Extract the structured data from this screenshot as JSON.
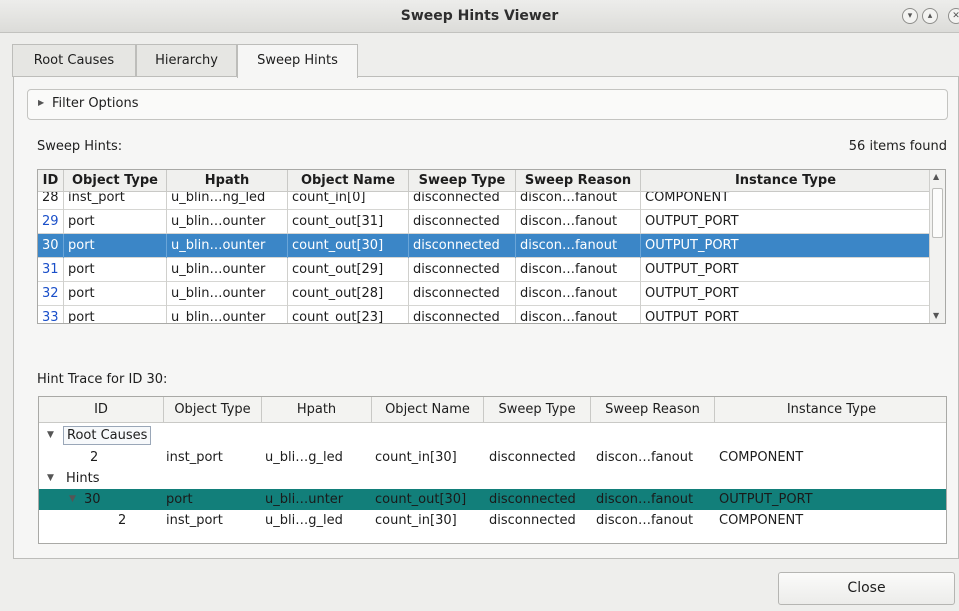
{
  "window": {
    "title": "Sweep Hints Viewer"
  },
  "tabs": [
    {
      "label": "Root Causes"
    },
    {
      "label": "Hierarchy"
    },
    {
      "label": "Sweep Hints",
      "active": true
    }
  ],
  "filter": {
    "label": "Filter Options"
  },
  "sweep_hints": {
    "label": "Sweep Hints:",
    "count": "56 items found",
    "columns": [
      "ID",
      "Object Type",
      "Hpath",
      "Object Name",
      "Sweep Type",
      "Sweep Reason",
      "Instance Type"
    ],
    "rows": [
      [
        "28",
        "inst_port",
        "u_blin…ng_led",
        "count_in[0]",
        "disconnected",
        "discon…fanout",
        "COMPONENT"
      ],
      [
        "29",
        "port",
        "u_blin…ounter",
        "count_out[31]",
        "disconnected",
        "discon…fanout",
        "OUTPUT_PORT"
      ],
      [
        "30",
        "port",
        "u_blin…ounter",
        "count_out[30]",
        "disconnected",
        "discon…fanout",
        "OUTPUT_PORT"
      ],
      [
        "31",
        "port",
        "u_blin…ounter",
        "count_out[29]",
        "disconnected",
        "discon…fanout",
        "OUTPUT_PORT"
      ],
      [
        "32",
        "port",
        "u_blin…ounter",
        "count_out[28]",
        "disconnected",
        "discon…fanout",
        "OUTPUT_PORT"
      ],
      [
        "33",
        "port",
        "u_blin…ounter",
        "count_out[23]",
        "disconnected",
        "discon…fanout",
        "OUTPUT_PORT"
      ]
    ],
    "selected_id": "30"
  },
  "hint_trace": {
    "label": "Hint Trace for ID 30:",
    "columns": [
      "ID",
      "Object Type",
      "Hpath",
      "Object Name",
      "Sweep Type",
      "Sweep Reason",
      "Instance Type"
    ],
    "groups": {
      "root_causes": {
        "label": "Root Causes",
        "rows": [
          [
            "2",
            "inst_port",
            "u_bli…g_led",
            "count_in[30]",
            "disconnected",
            "discon…fanout",
            "COMPONENT"
          ]
        ]
      },
      "hints": {
        "label": "Hints",
        "parent": [
          "30",
          "port",
          "u_bli…unter",
          "count_out[30]",
          "disconnected",
          "discon…fanout",
          "OUTPUT_PORT"
        ],
        "child": [
          "2",
          "inst_port",
          "u_bli…g_led",
          "count_in[30]",
          "disconnected",
          "discon…fanout",
          "COMPONENT"
        ]
      }
    }
  },
  "buttons": {
    "close": "Close"
  },
  "colors": {
    "selection": "#3b86c7",
    "trace_highlight": "#127f7a",
    "id_link": "#1a4fc9"
  }
}
